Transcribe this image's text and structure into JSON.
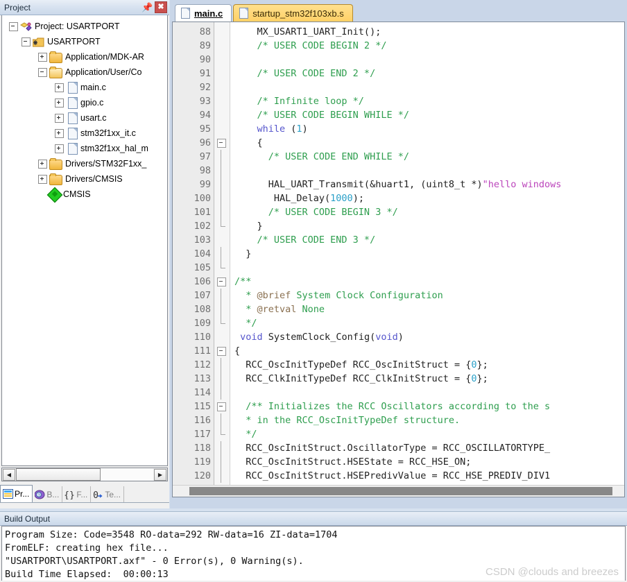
{
  "project_panel": {
    "title": "Project",
    "pin_icon": "pin-icon",
    "close_icon": "close-icon",
    "tree": [
      {
        "level": 0,
        "expander": "minus",
        "icon": "project-icon",
        "label": "Project: USARTPORT"
      },
      {
        "level": 1,
        "expander": "minus",
        "icon": "target-icon",
        "label": "USARTPORT"
      },
      {
        "level": 2,
        "expander": "plus",
        "icon": "folder-icon",
        "label": "Application/MDK-AR"
      },
      {
        "level": 2,
        "expander": "minus",
        "icon": "folder-open-icon",
        "label": "Application/User/Co"
      },
      {
        "level": 3,
        "expander": "plus",
        "icon": "file-icon",
        "label": "main.c"
      },
      {
        "level": 3,
        "expander": "plus",
        "icon": "file-icon",
        "label": "gpio.c"
      },
      {
        "level": 3,
        "expander": "plus",
        "icon": "file-icon",
        "label": "usart.c"
      },
      {
        "level": 3,
        "expander": "plus",
        "icon": "file-icon",
        "label": "stm32f1xx_it.c"
      },
      {
        "level": 3,
        "expander": "plus",
        "icon": "file-icon",
        "label": "stm32f1xx_hal_m"
      },
      {
        "level": 2,
        "expander": "plus",
        "icon": "folder-icon",
        "label": "Drivers/STM32F1xx_"
      },
      {
        "level": 2,
        "expander": "plus",
        "icon": "folder-icon",
        "label": "Drivers/CMSIS"
      },
      {
        "level": 2,
        "expander": "none",
        "icon": "cmsis-icon",
        "label": "CMSIS"
      }
    ],
    "hscroll": {
      "left_arrow": "◀",
      "right_arrow": "▶"
    },
    "tabs": [
      {
        "label": "Pr...",
        "icon": "project-window-icon",
        "active": true
      },
      {
        "label": "B...",
        "icon": "books-icon",
        "active": false
      },
      {
        "label": "F...",
        "icon": "functions-icon",
        "active": false
      },
      {
        "label": "Te...",
        "icon": "templates-icon",
        "active": false
      }
    ]
  },
  "editor": {
    "tabs": [
      {
        "label": "main.c",
        "active": true,
        "icon": "file-icon"
      },
      {
        "label": "startup_stm32f103xb.s",
        "active": false,
        "icon": "file-icon"
      }
    ],
    "first_line": 88,
    "lines": [
      {
        "n": 88,
        "fold": "none",
        "tokens": [
          {
            "t": "    MX_USART1_UART_Init();",
            "c": "txt"
          }
        ]
      },
      {
        "n": 89,
        "fold": "none",
        "tokens": [
          {
            "t": "    /* USER CODE BEGIN 2 */",
            "c": "cmt"
          }
        ]
      },
      {
        "n": 90,
        "fold": "none",
        "tokens": [
          {
            "t": "",
            "c": "txt"
          }
        ]
      },
      {
        "n": 91,
        "fold": "none",
        "tokens": [
          {
            "t": "    /* USER CODE END 2 */",
            "c": "cmt"
          }
        ]
      },
      {
        "n": 92,
        "fold": "none",
        "tokens": [
          {
            "t": "",
            "c": "txt"
          }
        ]
      },
      {
        "n": 93,
        "fold": "none",
        "tokens": [
          {
            "t": "    /* Infinite loop */",
            "c": "cmt"
          }
        ]
      },
      {
        "n": 94,
        "fold": "none",
        "tokens": [
          {
            "t": "    /* USER CODE BEGIN WHILE */",
            "c": "cmt"
          }
        ]
      },
      {
        "n": 95,
        "fold": "none",
        "tokens": [
          {
            "t": "    ",
            "c": "txt"
          },
          {
            "t": "while",
            "c": "kw"
          },
          {
            "t": " (",
            "c": "txt"
          },
          {
            "t": "1",
            "c": "num"
          },
          {
            "t": ")",
            "c": "txt"
          }
        ]
      },
      {
        "n": 96,
        "fold": "box",
        "tokens": [
          {
            "t": "    {",
            "c": "txt"
          }
        ]
      },
      {
        "n": 97,
        "fold": "line",
        "tokens": [
          {
            "t": "      /* USER CODE END WHILE */",
            "c": "cmt"
          }
        ]
      },
      {
        "n": 98,
        "fold": "line",
        "tokens": [
          {
            "t": "",
            "c": "txt"
          }
        ]
      },
      {
        "n": 99,
        "fold": "line",
        "tokens": [
          {
            "t": "      HAL_UART_Transmit(&huart1, (uint8_t *)",
            "c": "txt"
          },
          {
            "t": "\"hello windows",
            "c": "str"
          }
        ]
      },
      {
        "n": 100,
        "fold": "line",
        "tokens": [
          {
            "t": "       HAL_Delay(",
            "c": "txt"
          },
          {
            "t": "1000",
            "c": "num"
          },
          {
            "t": ");",
            "c": "txt"
          }
        ]
      },
      {
        "n": 101,
        "fold": "line",
        "tokens": [
          {
            "t": "      /* USER CODE BEGIN 3 */",
            "c": "cmt"
          }
        ]
      },
      {
        "n": 102,
        "fold": "end",
        "tokens": [
          {
            "t": "    }",
            "c": "txt"
          }
        ]
      },
      {
        "n": 103,
        "fold": "none",
        "tokens": [
          {
            "t": "    /* USER CODE END 3 */",
            "c": "cmt"
          }
        ]
      },
      {
        "n": 104,
        "fold": "line2",
        "tokens": [
          {
            "t": "  }",
            "c": "txt"
          }
        ]
      },
      {
        "n": 105,
        "fold": "end",
        "tokens": [
          {
            "t": "",
            "c": "txt"
          }
        ]
      },
      {
        "n": 106,
        "fold": "box",
        "tokens": [
          {
            "t": "/**",
            "c": "cmt"
          }
        ]
      },
      {
        "n": 107,
        "fold": "line",
        "tokens": [
          {
            "t": "  * ",
            "c": "cmt"
          },
          {
            "t": "@brief",
            "c": "doc"
          },
          {
            "t": " System Clock Configuration",
            "c": "cmt"
          }
        ]
      },
      {
        "n": 108,
        "fold": "line",
        "tokens": [
          {
            "t": "  * ",
            "c": "cmt"
          },
          {
            "t": "@retval",
            "c": "doc"
          },
          {
            "t": " None",
            "c": "cmt"
          }
        ]
      },
      {
        "n": 109,
        "fold": "end",
        "tokens": [
          {
            "t": "  */",
            "c": "cmt"
          }
        ]
      },
      {
        "n": 110,
        "fold": "none",
        "tokens": [
          {
            "t": " ",
            "c": "txt"
          },
          {
            "t": "void",
            "c": "kw"
          },
          {
            "t": " SystemClock_Config(",
            "c": "txt"
          },
          {
            "t": "void",
            "c": "kw"
          },
          {
            "t": ")",
            "c": "txt"
          }
        ]
      },
      {
        "n": 111,
        "fold": "box",
        "tokens": [
          {
            "t": "{",
            "c": "txt"
          }
        ]
      },
      {
        "n": 112,
        "fold": "line",
        "tokens": [
          {
            "t": "  RCC_OscInitTypeDef RCC_OscInitStruct = {",
            "c": "txt"
          },
          {
            "t": "0",
            "c": "num"
          },
          {
            "t": "};",
            "c": "txt"
          }
        ]
      },
      {
        "n": 113,
        "fold": "line",
        "tokens": [
          {
            "t": "  RCC_ClkInitTypeDef RCC_ClkInitStruct = {",
            "c": "txt"
          },
          {
            "t": "0",
            "c": "num"
          },
          {
            "t": "};",
            "c": "txt"
          }
        ]
      },
      {
        "n": 114,
        "fold": "line",
        "tokens": [
          {
            "t": "",
            "c": "txt"
          }
        ]
      },
      {
        "n": 115,
        "fold": "box2",
        "tokens": [
          {
            "t": "  /** Initializes the RCC Oscillators according to the s",
            "c": "cmt"
          }
        ]
      },
      {
        "n": 116,
        "fold": "line",
        "tokens": [
          {
            "t": "  * in the RCC_OscInitTypeDef structure.",
            "c": "cmt"
          }
        ]
      },
      {
        "n": 117,
        "fold": "end",
        "tokens": [
          {
            "t": "  */",
            "c": "cmt"
          }
        ]
      },
      {
        "n": 118,
        "fold": "line",
        "tokens": [
          {
            "t": "  RCC_OscInitStruct.OscillatorType = RCC_OSCILLATORTYPE_",
            "c": "txt"
          }
        ]
      },
      {
        "n": 119,
        "fold": "line",
        "tokens": [
          {
            "t": "  RCC_OscInitStruct.HSEState = RCC_HSE_ON;",
            "c": "txt"
          }
        ]
      },
      {
        "n": 120,
        "fold": "line",
        "tokens": [
          {
            "t": "  RCC_OscInitStruct.HSEPredivValue = RCC_HSE_PREDIV_DIV1",
            "c": "txt"
          }
        ]
      }
    ]
  },
  "build_output": {
    "title": "Build Output",
    "lines": [
      "Program Size: Code=3548 RO-data=292 RW-data=16 ZI-data=1704",
      "FromELF: creating hex file...",
      "\"USARTPORT\\USARTPORT.axf\" - 0 Error(s), 0 Warning(s).",
      "Build Time Elapsed:  00:00:13"
    ]
  },
  "watermark": "CSDN @clouds and breezes",
  "colors": {
    "comment": "#2e9e4e",
    "keyword": "#5555cc",
    "number": "#2aa0c8",
    "string": "#bb44bb",
    "doc_tag": "#8a7050",
    "tab_inactive": "#ffd066",
    "panel_title": "#d7e2f0",
    "close_button": "#c9504e"
  }
}
